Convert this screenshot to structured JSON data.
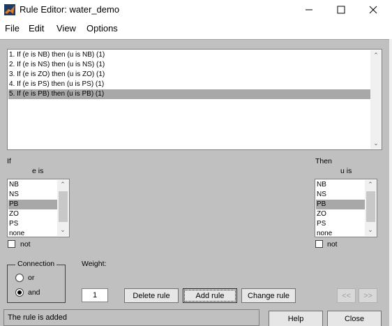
{
  "window": {
    "title": "Rule Editor: water_demo"
  },
  "menu": [
    "File",
    "Edit",
    "View",
    "Options"
  ],
  "rules": [
    "1. If (e is NB) then (u is NB) (1)",
    "2. If (e is NS) then (u is NS) (1)",
    "3. If (e is ZO) then (u is ZO) (1)",
    "4. If (e is PS) then (u is PS) (1)",
    "5. If (e is PB) then (u is PB) (1)"
  ],
  "selected_rule": 5,
  "if_section": {
    "header": "If",
    "var_label": "e is",
    "options": [
      "NB",
      "NS",
      "PB",
      "ZO",
      "PS",
      "none"
    ],
    "selected": "PB",
    "not_label": "not"
  },
  "then_section": {
    "header": "Then",
    "var_label": "u is",
    "options": [
      "NB",
      "NS",
      "PB",
      "ZO",
      "PS",
      "none"
    ],
    "selected": "PB",
    "not_label": "not"
  },
  "connection": {
    "label": "Connection",
    "options": [
      "or",
      "and"
    ],
    "selected": "and"
  },
  "weight": {
    "label": "Weight:",
    "value": "1"
  },
  "buttons": {
    "delete": "Delete rule",
    "add": "Add rule",
    "change": "Change rule",
    "prev": "<<",
    "next": ">>",
    "help": "Help",
    "close": "Close"
  },
  "status": "The rule is added"
}
